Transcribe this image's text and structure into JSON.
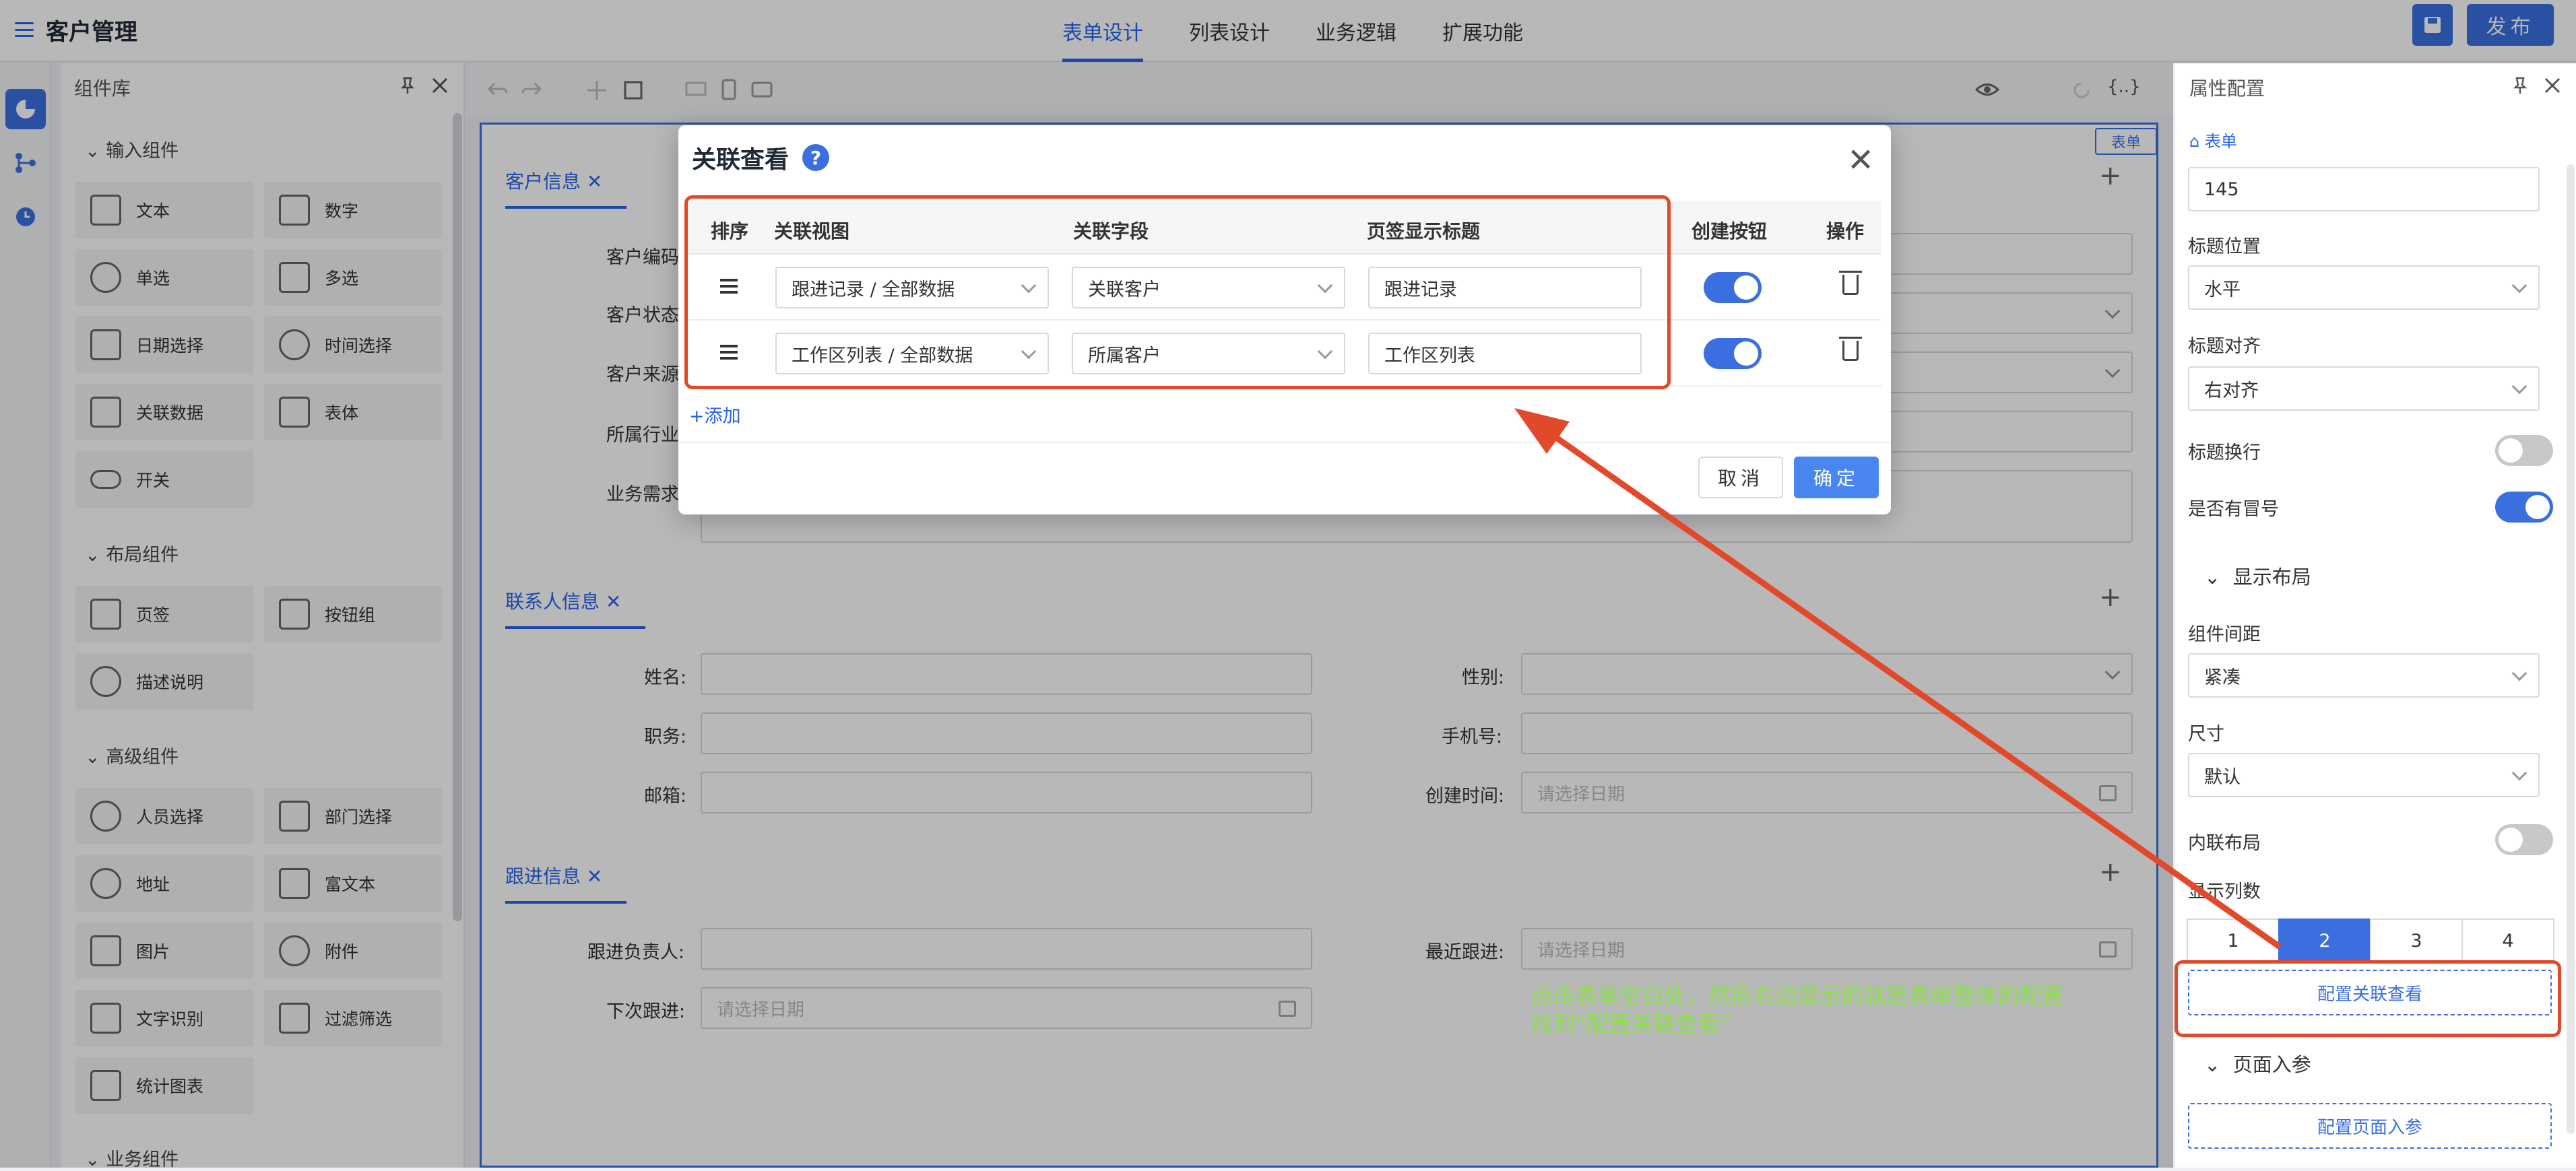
{
  "app": {
    "title": "客户管理",
    "publish_label": "发布"
  },
  "tabs": [
    {
      "label": "表单设计"
    },
    {
      "label": "列表设计"
    },
    {
      "label": "业务逻辑"
    },
    {
      "label": "扩展功能"
    }
  ],
  "library": {
    "title": "组件库",
    "groups": [
      {
        "title": "输入组件",
        "items": [
          {
            "label": "文本"
          },
          {
            "label": "数字"
          },
          {
            "label": "单选"
          },
          {
            "label": "多选"
          },
          {
            "label": "日期选择"
          },
          {
            "label": "时间选择"
          },
          {
            "label": "关联数据"
          },
          {
            "label": "表体"
          },
          {
            "label": "开关"
          }
        ]
      },
      {
        "title": "布局组件",
        "items": [
          {
            "label": "页签"
          },
          {
            "label": "按钮组"
          },
          {
            "label": "描述说明"
          }
        ]
      },
      {
        "title": "高级组件",
        "items": [
          {
            "label": "人员选择"
          },
          {
            "label": "部门选择"
          },
          {
            "label": "地址"
          },
          {
            "label": "富文本"
          },
          {
            "label": "图片"
          },
          {
            "label": "附件"
          },
          {
            "label": "文字识别"
          },
          {
            "label": "过滤筛选"
          },
          {
            "label": "统计图表"
          }
        ]
      },
      {
        "title": "业务组件",
        "items": []
      }
    ]
  },
  "canvas": {
    "form_tag": "表单",
    "sections": [
      {
        "title": "客户信息",
        "fields": [
          {
            "label": "客户编码"
          },
          {
            "label": "客户状态"
          },
          {
            "label": "客户来源"
          },
          {
            "label": "所属行业"
          },
          {
            "label": "业务需求"
          }
        ]
      },
      {
        "title": "联系人信息",
        "fields": [
          {
            "label": "姓名:"
          },
          {
            "label": "性别:"
          },
          {
            "label": "职务:"
          },
          {
            "label": "手机号:"
          },
          {
            "label": "邮箱:"
          },
          {
            "label": "创建时间:",
            "placeholder": "请选择日期"
          }
        ]
      },
      {
        "title": "跟进信息",
        "fields": [
          {
            "label": "跟进负责人:"
          },
          {
            "label": "最近跟进:",
            "placeholder": "请选择日期"
          },
          {
            "label": "下次跟进:",
            "placeholder": "请选择日期"
          }
        ]
      }
    ]
  },
  "props": {
    "title": "属性配置",
    "breadcrumb": "表单",
    "width_value": "145",
    "label_position": {
      "label": "标题位置",
      "value": "水平"
    },
    "label_align": {
      "label": "标题对齐",
      "value": "右对齐"
    },
    "label_wrap": {
      "label": "标题换行",
      "on": false
    },
    "has_colon": {
      "label": "是否有冒号",
      "on": true
    },
    "layout_section": "显示布局",
    "spacing": {
      "label": "组件间距",
      "value": "紧凑"
    },
    "size": {
      "label": "尺寸",
      "value": "默认"
    },
    "inline": {
      "label": "内联布局",
      "on": false
    },
    "columns": {
      "label": "显示列数",
      "options": [
        "1",
        "2",
        "3",
        "4"
      ],
      "selected": "2"
    },
    "config_related": "配置关联查看",
    "params_section": "页面入参",
    "config_params": "配置页面入参"
  },
  "modal": {
    "title": "关联查看",
    "headers": [
      "排序",
      "关联视图",
      "关联字段",
      "页签显示标题",
      "创建按钮",
      "操作"
    ],
    "rows": [
      {
        "view": "跟进记录 / 全部数据",
        "field": "关联客户",
        "tab_title": "跟进记录",
        "create_on": true
      },
      {
        "view": "工作区列表 / 全部数据",
        "field": "所属客户",
        "tab_title": "工作区列表",
        "create_on": true
      }
    ],
    "add_label": "+添加",
    "cancel_label": "取消",
    "confirm_label": "确定"
  },
  "annotation": {
    "line1": "点击表单空白处，然后右边显示的就是表单整体的配置",
    "line2": "找到“配置关联查看”",
    "color": "#8be04a"
  },
  "colors": {
    "accent": "#3b6fe0",
    "highlight": "#e2482a"
  }
}
